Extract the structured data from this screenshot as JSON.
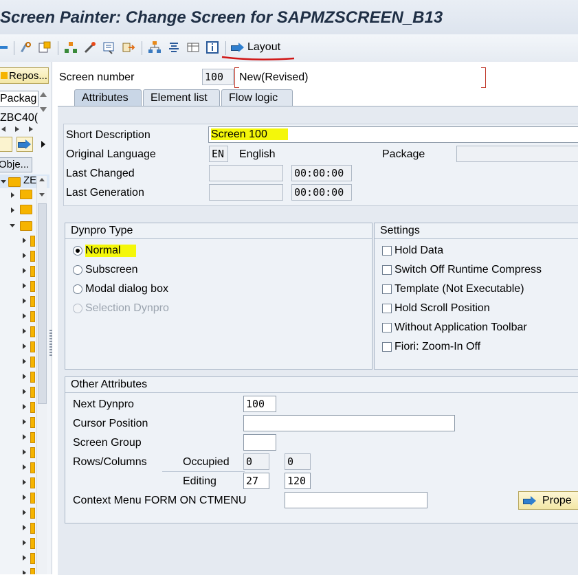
{
  "window": {
    "title": "Screen Painter: Change Screen for SAPMZSCREEN_B13"
  },
  "toolbar": {
    "layout_label": "Layout",
    "accent_underline": "#d01515"
  },
  "left_pane": {
    "repos_button": "Repos...",
    "package_label": "Packag",
    "package_value": "ZBC40(",
    "objects_button": "Obje...",
    "tree_root": "ZE"
  },
  "header": {
    "screen_number_label": "Screen number",
    "screen_number": "100",
    "screen_status": "New(Revised)"
  },
  "tabs": [
    {
      "label": "Attributes",
      "active": true
    },
    {
      "label": "Element list",
      "active": false
    },
    {
      "label": "Flow logic",
      "active": false
    }
  ],
  "attributes": {
    "short_description_label": "Short Description",
    "short_description": "Screen 100",
    "original_language_label": "Original Language",
    "language_code": "EN",
    "language_name": "English",
    "package_label": "Package",
    "package_value": "",
    "last_changed_label": "Last Changed",
    "last_changed_date": "",
    "last_changed_time": "00:00:00",
    "last_generation_label": "Last Generation",
    "last_generation_date": "",
    "last_generation_time": "00:00:00"
  },
  "dynpro_type": {
    "title": "Dynpro Type",
    "options": [
      {
        "label": "Normal",
        "selected": true,
        "enabled": true
      },
      {
        "label": "Subscreen",
        "selected": false,
        "enabled": true
      },
      {
        "label": "Modal dialog box",
        "selected": false,
        "enabled": true
      },
      {
        "label": "Selection Dynpro",
        "selected": false,
        "enabled": false
      }
    ]
  },
  "settings": {
    "title": "Settings",
    "options": [
      {
        "label": "Hold Data",
        "checked": false
      },
      {
        "label": "Switch Off Runtime Compress",
        "checked": false
      },
      {
        "label": "Template (Not Executable)",
        "checked": false
      },
      {
        "label": "Hold Scroll Position",
        "checked": false
      },
      {
        "label": "Without Application Toolbar",
        "checked": false
      },
      {
        "label": "Fiori: Zoom-In Off",
        "checked": false
      }
    ]
  },
  "other_attributes": {
    "title": "Other Attributes",
    "next_dynpro_label": "Next Dynpro",
    "next_dynpro": "100",
    "cursor_position_label": "Cursor Position",
    "cursor_position": "",
    "screen_group_label": "Screen Group",
    "screen_group": "",
    "rows_columns_label": "Rows/Columns",
    "occupied_label": "Occupied",
    "occupied_rows": "0",
    "occupied_cols": "0",
    "editing_label": "Editing",
    "editing_rows": "27",
    "editing_cols": "120",
    "context_menu_label": "Context Menu FORM ON CTMENU",
    "context_menu": "",
    "properties_button": "Prope"
  },
  "colors": {
    "highlight": "#f4f70a",
    "title_text": "#1f2f45",
    "panel_bg": "#e5eaf1"
  }
}
